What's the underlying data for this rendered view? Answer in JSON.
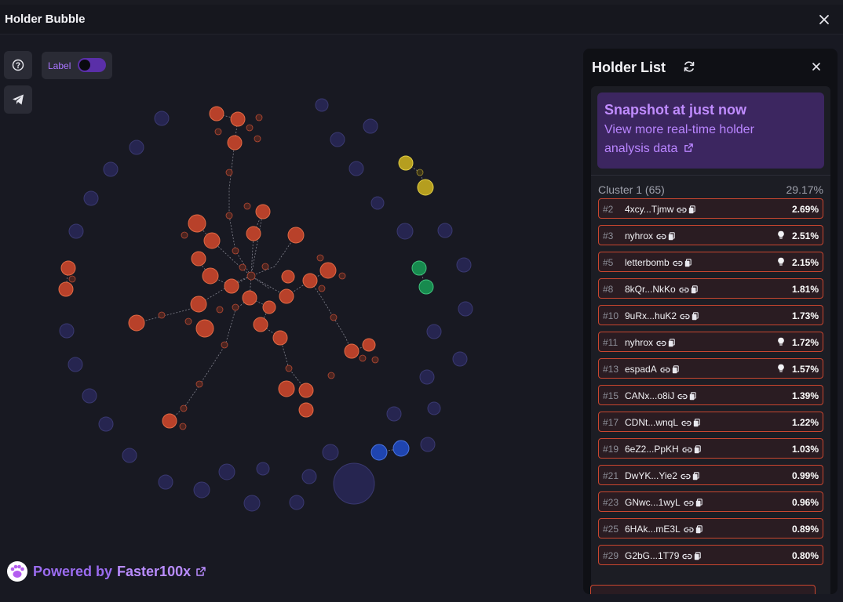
{
  "window": {
    "title": "Holder Bubble"
  },
  "toolbar": {
    "label_toggle_text": "Label",
    "label_toggle_on": true
  },
  "footer": {
    "powered_by": "Powered by",
    "brand": "Faster100x"
  },
  "holder_list": {
    "title": "Holder List",
    "snapshot": {
      "title": "Snapshot at just now",
      "link_line1": "View more real-time holder",
      "link_line2": "analysis data"
    },
    "cluster": {
      "name": "Cluster 1 (65)",
      "percent": "29.17%"
    },
    "rows": [
      {
        "rank": "#2",
        "address": "4xcy...Tjmw",
        "percent": "2.69%",
        "bulb": false
      },
      {
        "rank": "#3",
        "address": "nyhrox",
        "percent": "2.51%",
        "bulb": true
      },
      {
        "rank": "#5",
        "address": "letterbomb",
        "percent": "2.15%",
        "bulb": true
      },
      {
        "rank": "#8",
        "address": "8kQr...NkKo",
        "percent": "1.81%",
        "bulb": false
      },
      {
        "rank": "#10",
        "address": "9uRx...huK2",
        "percent": "1.73%",
        "bulb": false
      },
      {
        "rank": "#11",
        "address": "nyhrox",
        "percent": "1.72%",
        "bulb": true
      },
      {
        "rank": "#13",
        "address": "espadA",
        "percent": "1.57%",
        "bulb": true
      },
      {
        "rank": "#15",
        "address": "CANx...o8iJ",
        "percent": "1.39%",
        "bulb": false
      },
      {
        "rank": "#17",
        "address": "CDNt...wnqL",
        "percent": "1.22%",
        "bulb": false
      },
      {
        "rank": "#19",
        "address": "6eZ2...PpKH",
        "percent": "1.03%",
        "bulb": false
      },
      {
        "rank": "#21",
        "address": "DwYK...Yie2",
        "percent": "0.99%",
        "bulb": false
      },
      {
        "rank": "#23",
        "address": "GNwc...1wyL",
        "percent": "0.96%",
        "bulb": false
      },
      {
        "rank": "#25",
        "address": "6HAk...mE3L",
        "percent": "0.89%",
        "bulb": false
      },
      {
        "rank": "#29",
        "address": "G2bG...1T79",
        "percent": "0.80%",
        "bulb": false
      }
    ]
  },
  "colors": {
    "accent": "#a975ff",
    "cluster_red": "#d0452a",
    "cluster_yellow": "#c7b62a",
    "cluster_green": "#1e9e5c",
    "cluster_blue": "#2952c4",
    "idle_bubble": "#262550"
  },
  "icons": {
    "close": "close-icon",
    "help": "help-icon",
    "telegram": "telegram-icon",
    "refresh": "refresh-icon",
    "link": "link-icon",
    "copy": "copy-icon",
    "bulb": "bulb-icon",
    "external": "external-link-icon",
    "paw": "paw-icon"
  }
}
